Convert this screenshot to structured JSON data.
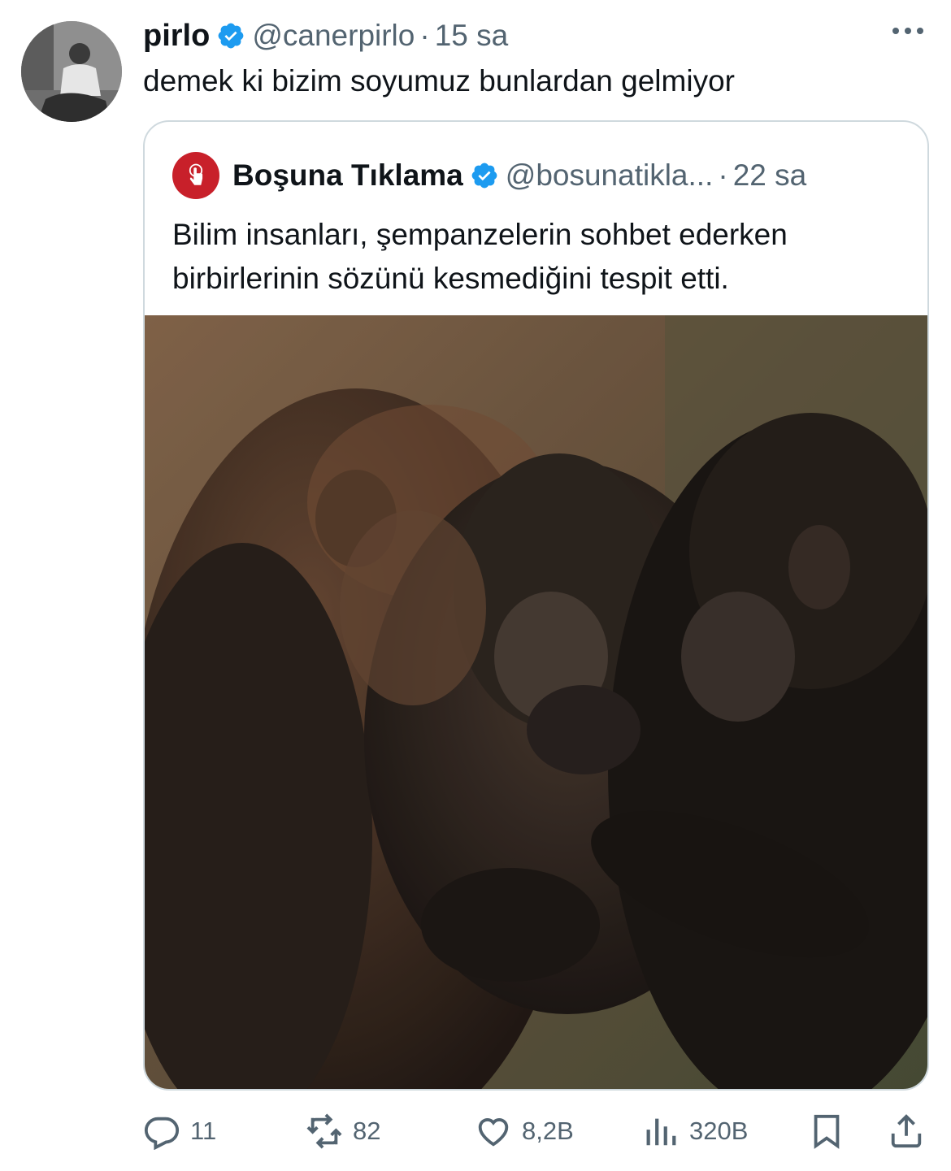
{
  "tweet": {
    "author": {
      "display_name": "pirlo",
      "handle": "@canerpirlo",
      "verified": true
    },
    "separator": "·",
    "time": "15 sa",
    "text": "demek ki bizim soyumuz bunlardan gelmiyor",
    "quote": {
      "author": {
        "display_name": "Boşuna Tıklama",
        "handle": "@bosunatikla...",
        "verified": true
      },
      "separator": "·",
      "time": "22 sa",
      "text": "Bilim insanları, şempanzelerin sohbet ederken birbirlerinin sözünü kesmediğini tespit etti.",
      "image_alt": "chimpanzees-photo"
    },
    "actions": {
      "replies": "11",
      "reposts": "82",
      "likes": "8,2B",
      "views": "320B"
    }
  },
  "colors": {
    "text_primary": "#0f1419",
    "text_secondary": "#536471",
    "verified_blue": "#1d9bf0",
    "border": "#cfd9de",
    "brand_red": "#c8202a"
  },
  "icons": [
    "verified-badge-icon",
    "more-icon",
    "reply-icon",
    "repost-icon",
    "like-icon",
    "views-icon",
    "bookmark-icon",
    "share-icon"
  ]
}
